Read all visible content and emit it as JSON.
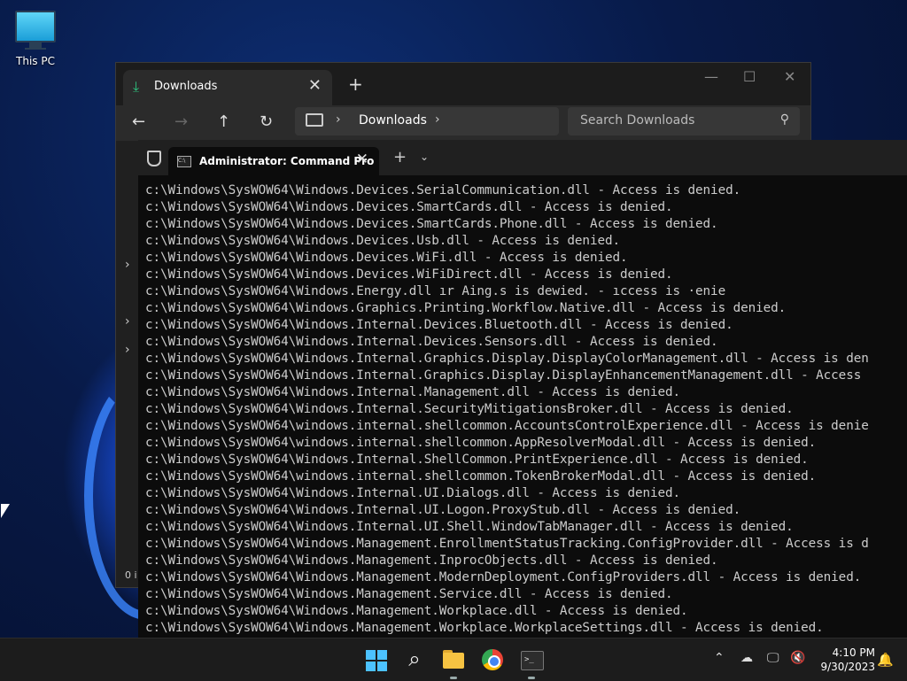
{
  "desktop": {
    "this_pc_label": "This PC"
  },
  "explorer": {
    "tab_title": "Downloads",
    "close_glyph": "✕",
    "new_tab_glyph": "+",
    "minimize_glyph": "—",
    "maximize_glyph": "☐",
    "window_close_glyph": "✕",
    "back_glyph": "←",
    "forward_glyph": "→",
    "up_glyph": "↑",
    "refresh_glyph": "↻",
    "breadcrumb_path": "Downloads",
    "chevron_glyph": "›",
    "search_placeholder": "Search Downloads",
    "side_chevron": "›",
    "status_partial": "0 i"
  },
  "terminal": {
    "tab_title": "Administrator: Command Pro",
    "close_glyph": "✕",
    "new_tab_glyph": "+",
    "dropdown_glyph": "⌄",
    "icon_text": "C:\\",
    "lines": [
      "c:\\Windows\\SysWOW64\\Windows.Devices.SerialCommunication.dll - Access is denied.",
      "c:\\Windows\\SysWOW64\\Windows.Devices.SmartCards.dll - Access is denied.",
      "c:\\Windows\\SysWOW64\\Windows.Devices.SmartCards.Phone.dll - Access is denied.",
      "c:\\Windows\\SysWOW64\\Windows.Devices.Usb.dll - Access is denied.",
      "c:\\Windows\\SysWOW64\\Windows.Devices.WiFi.dll - Access is denied.",
      "c:\\Windows\\SysWOW64\\Windows.Devices.WiFiDirect.dll - Access is denied.",
      "c:\\Windows\\SysWOW64\\Windows.Energy.dll ır Aing.s is dewied. - ıccess is ·enie",
      "c:\\Windows\\SysWOW64\\Windows.Graphics.Printing.Workflow.Native.dll - Access is denied.",
      "c:\\Windows\\SysWOW64\\Windows.Internal.Devices.Bluetooth.dll - Access is denied.",
      "c:\\Windows\\SysWOW64\\Windows.Internal.Devices.Sensors.dll - Access is denied.",
      "c:\\Windows\\SysWOW64\\Windows.Internal.Graphics.Display.DisplayColorManagement.dll - Access is den",
      "c:\\Windows\\SysWOW64\\Windows.Internal.Graphics.Display.DisplayEnhancementManagement.dll - Access",
      "c:\\Windows\\SysWOW64\\Windows.Internal.Management.dll - Access is denied.",
      "c:\\Windows\\SysWOW64\\Windows.Internal.SecurityMitigationsBroker.dll - Access is denied.",
      "c:\\Windows\\SysWOW64\\windows.internal.shellcommon.AccountsControlExperience.dll - Access is denie",
      "c:\\Windows\\SysWOW64\\windows.internal.shellcommon.AppResolverModal.dll - Access is denied.",
      "c:\\Windows\\SysWOW64\\Windows.Internal.ShellCommon.PrintExperience.dll - Access is denied.",
      "c:\\Windows\\SysWOW64\\windows.internal.shellcommon.TokenBrokerModal.dll - Access is denied.",
      "c:\\Windows\\SysWOW64\\Windows.Internal.UI.Dialogs.dll - Access is denied.",
      "c:\\Windows\\SysWOW64\\Windows.Internal.UI.Logon.ProxyStub.dll - Access is denied.",
      "c:\\Windows\\SysWOW64\\Windows.Internal.UI.Shell.WindowTabManager.dll - Access is denied.",
      "c:\\Windows\\SysWOW64\\Windows.Management.EnrollmentStatusTracking.ConfigProvider.dll - Access is d",
      "c:\\Windows\\SysWOW64\\Windows.Management.InprocObjects.dll - Access is denied.",
      "c:\\Windows\\SysWOW64\\Windows.Management.ModernDeployment.ConfigProviders.dll - Access is denied.",
      "c:\\Windows\\SysWOW64\\Windows.Management.Service.dll - Access is denied.",
      "c:\\Windows\\SysWOW64\\Windows.Management.Workplace.dll - Access is denied.",
      "c:\\Windows\\SysWOW64\\Windows.Management.Workplace.WorkplaceSettings.dll - Access is denied."
    ]
  },
  "taskbar": {
    "search_glyph": "⌕",
    "tray_chevron": "⌃",
    "time": "4:10 PM",
    "date": "9/30/2023",
    "bell_glyph": "🔔"
  },
  "colors": {
    "accent": "#4cc2ff",
    "download_green": "#2ec27e",
    "terminal_bg": "#0c0c0c",
    "terminal_fg": "#cccccc"
  }
}
